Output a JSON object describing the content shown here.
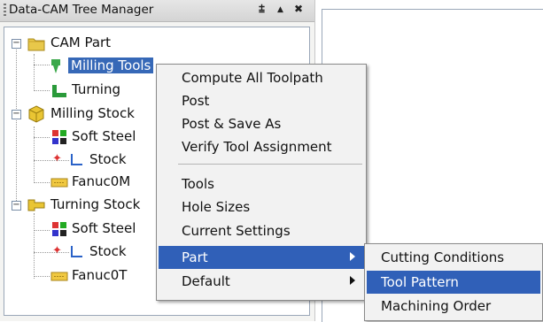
{
  "panel": {
    "title": "Data-CAM Tree Manager",
    "pin_glyph": "⩲",
    "menu_glyph": "▲",
    "close_glyph": "✖"
  },
  "tree": {
    "cam_part": "CAM Part",
    "milling_tools": "Milling Tools",
    "turning": "Turning",
    "milling_stock": "Milling Stock",
    "soft_steel_1": "Soft Steel",
    "stock_1": "Stock",
    "fanuc_1": "Fanuc0M",
    "turning_stock": "Turning Stock",
    "soft_steel_2": "Soft Steel",
    "stock_2": "Stock",
    "fanuc_2": "Fanuc0T"
  },
  "context_menu": {
    "compute": "Compute All Toolpath",
    "post": "Post",
    "post_save": "Post & Save As",
    "verify": "Verify Tool Assignment",
    "tools": "Tools",
    "hole_sizes": "Hole Sizes",
    "current_settings": "Current Settings",
    "part": "Part",
    "default": "Default"
  },
  "submenu": {
    "cutting_conditions": "Cutting Conditions",
    "tool_pattern": "Tool Pattern",
    "machining_order": "Machining Order"
  },
  "colors": {
    "selection": "#3060b8",
    "titlebar": "#d4d4d4",
    "menu_bg": "#f2f2f2"
  }
}
